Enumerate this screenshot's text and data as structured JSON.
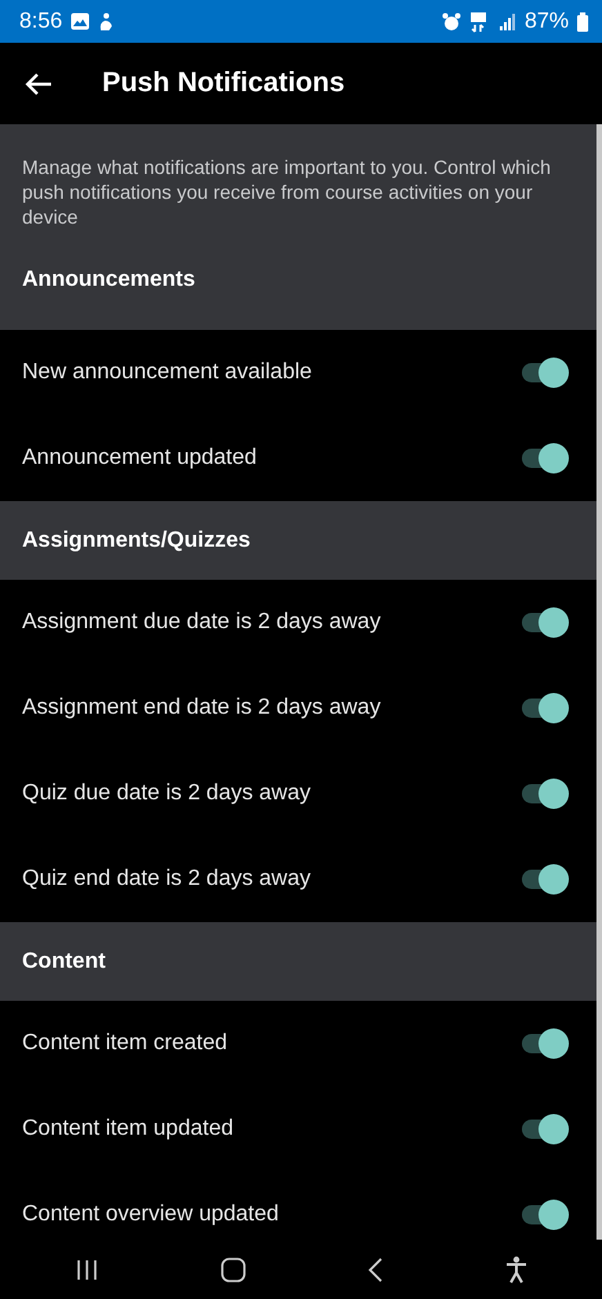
{
  "status_bar": {
    "time": "8:56",
    "battery": "87%"
  },
  "app_bar": {
    "title": "Push Notifications"
  },
  "description": "Manage what notifications are important to you. Control which push notifications you receive from course activities on your device",
  "sections": [
    {
      "title": "Announcements",
      "items": [
        {
          "label": "New announcement available",
          "on": true
        },
        {
          "label": "Announcement updated",
          "on": true
        }
      ]
    },
    {
      "title": "Assignments/Quizzes",
      "items": [
        {
          "label": "Assignment due date is 2 days away",
          "on": true
        },
        {
          "label": "Assignment end date is 2 days away",
          "on": true
        },
        {
          "label": "Quiz due date is 2 days away",
          "on": true
        },
        {
          "label": "Quiz end date is 2 days away",
          "on": true
        }
      ]
    },
    {
      "title": "Content",
      "items": [
        {
          "label": "Content item created",
          "on": true
        },
        {
          "label": "Content item updated",
          "on": true
        },
        {
          "label": "Content overview updated",
          "on": true
        }
      ]
    }
  ]
}
